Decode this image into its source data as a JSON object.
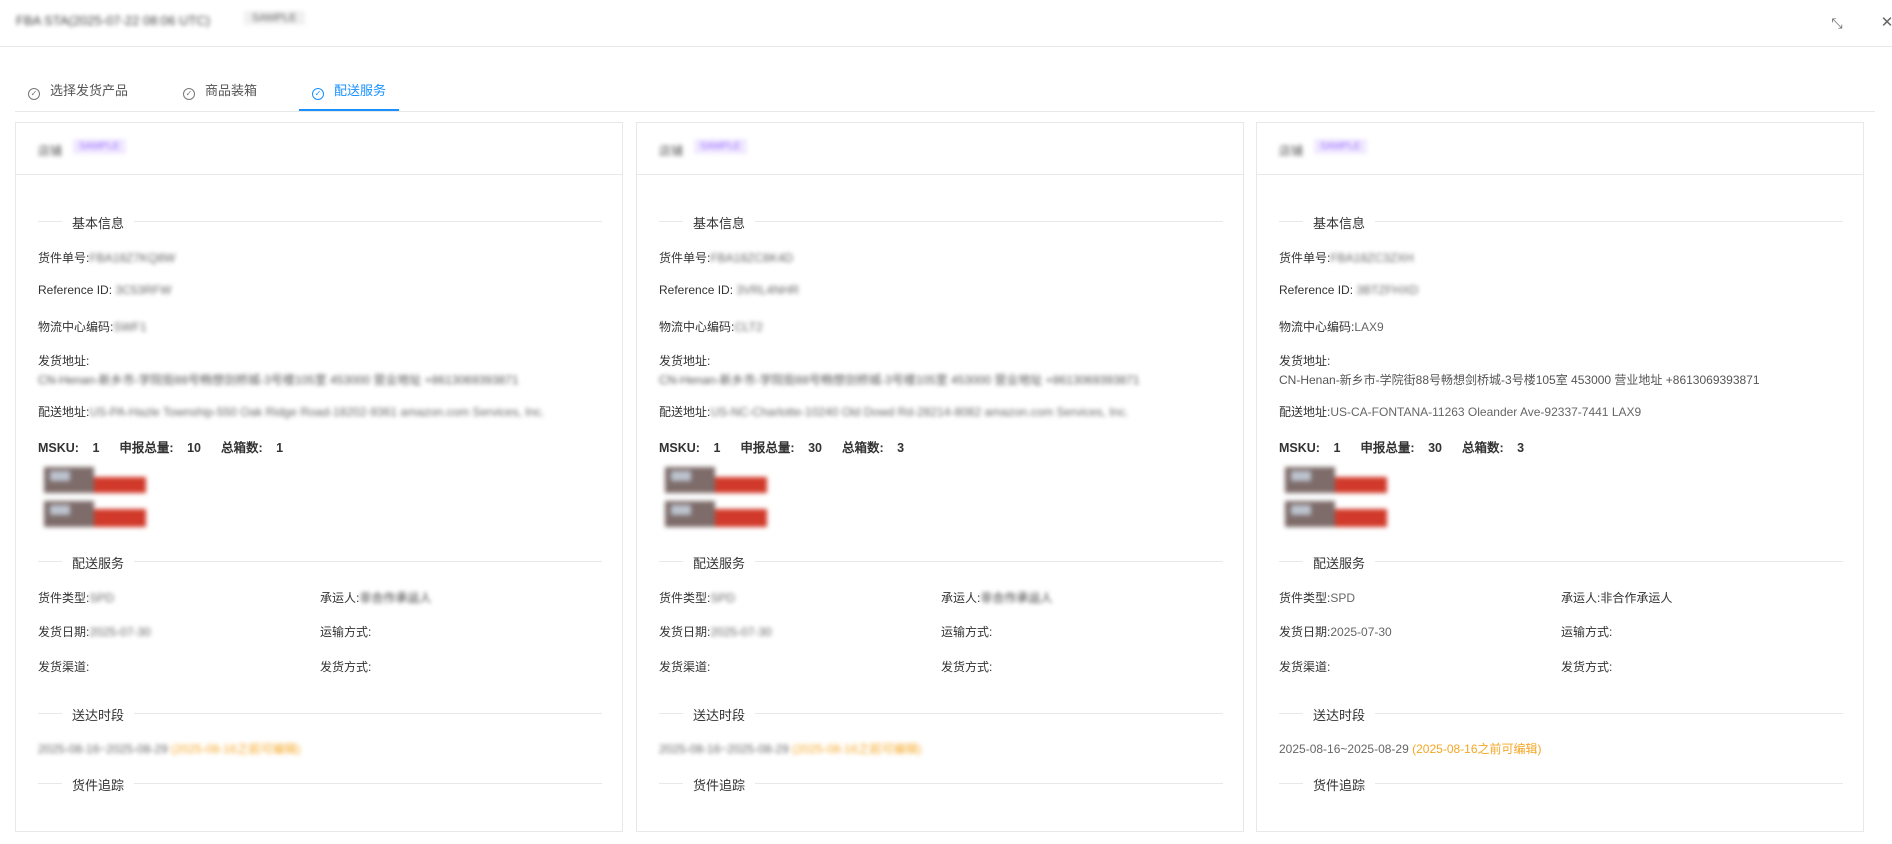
{
  "window": {
    "title": "FBA STA(2025-07-22 08:06 UTC)",
    "title_badge": "SAMPLE",
    "fullscreen_icon": "⤡",
    "close_icon": "✕"
  },
  "tabs": [
    {
      "label": "选择发货产品"
    },
    {
      "label": "商品装箱"
    },
    {
      "label": "配送服务"
    }
  ],
  "tab_check_icon": "✓",
  "labels": {
    "basic_info": "基本信息",
    "shipment_no": "货件单号:",
    "reference_id": "Reference ID:",
    "fc_code": "物流中心编码:",
    "ship_from": "发货地址:",
    "ship_to": "配送地址:",
    "msku": "MSKU:",
    "declared_total": "申报总量:",
    "total_boxes": "总箱数:",
    "delivery_service": "配送服务",
    "shipment_type": "货件类型:",
    "carrier": "承运人:",
    "ship_date": "发货日期:",
    "transport_mode": "运输方式:",
    "ship_channel": "发货渠道:",
    "ship_method": "发货方式:",
    "delivery_window": "送达时段",
    "tracking": "货件追踪"
  },
  "cards": [
    {
      "shop_label": "店铺",
      "shop_tag": "SAMPLE",
      "shipment_no": "FBA18Z7KQ8W",
      "reference_id": "3C53RFW",
      "fc_code": "SWF1",
      "ship_from": "CN-Henan-新乡市-学院街88号畅想剑桥城-3号楼105室 453000 营业地址 +8613069393871",
      "ship_to": "US-PA-Hazle Township-550 Oak Ridge Road-18202-9361 amazon.com Services, Inc.",
      "msku": "1",
      "declared_total": "10",
      "total_boxes": "1",
      "shipment_type": "SPD",
      "carrier": "非合作承运人",
      "ship_date": "2025-07-30",
      "transport_mode": "",
      "ship_channel": "",
      "ship_method": "",
      "delivery_window": "2025-08-16~2025-08-29",
      "edit_note": "(2025-08-16之前可编辑)"
    },
    {
      "shop_label": "店铺",
      "shop_tag": "SAMPLE",
      "shipment_no": "FBA18ZC8K4D",
      "reference_id": "3VRL4NHR",
      "fc_code": "CLT2",
      "ship_from": "CN-Henan-新乡市-学院街88号畅想剑桥城-3号楼105室 453000 营业地址 +8613069393871",
      "ship_to": "US-NC-Charlotte-10240 Old Dowd Rd-28214-8082 amazon.com Services, Inc.",
      "msku": "1",
      "declared_total": "30",
      "total_boxes": "3",
      "shipment_type": "SPD",
      "carrier": "非合作承运人",
      "ship_date": "2025-07-30",
      "transport_mode": "",
      "ship_channel": "",
      "ship_method": "",
      "delivery_window": "2025-08-16~2025-08-29",
      "edit_note": "(2025-08-16之前可编辑)"
    },
    {
      "shop_label": "店铺",
      "shop_tag": "SAMPLE",
      "shipment_no": "FBA18ZC3ZXH",
      "reference_id": "3BTZFHXD",
      "fc_code": "LAX9",
      "ship_from": "CN-Henan-新乡市-学院街88号畅想剑桥城-3号楼105室 453000 营业地址 +8613069393871",
      "ship_to": "US-CA-FONTANA-11263 Oleander Ave-92337-7441 LAX9",
      "msku": "1",
      "declared_total": "30",
      "total_boxes": "3",
      "shipment_type": "SPD",
      "carrier": "非合作承运人",
      "ship_date": "2025-07-30",
      "transport_mode": "",
      "ship_channel": "",
      "ship_method": "",
      "delivery_window": "2025-08-16~2025-08-29",
      "edit_note": "(2025-08-16之前可编辑)"
    }
  ],
  "colors": {
    "accent": "#1890ff",
    "orange": "#f5a623",
    "border": "#e8e8e8",
    "tag_bg": "#f0e9ff",
    "tag_fg": "#9a6bff"
  }
}
